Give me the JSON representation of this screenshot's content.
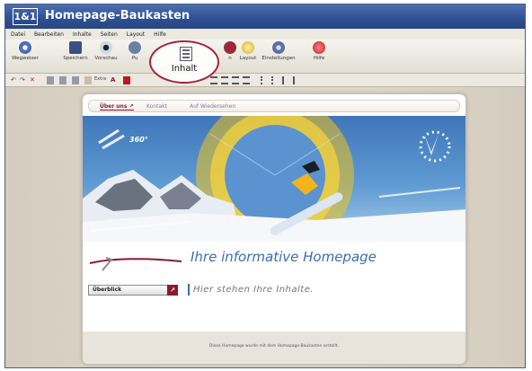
{
  "app": {
    "logo": "1&1",
    "title": "Homepage-Baukasten"
  },
  "menu": [
    "Datei",
    "Bearbeiten",
    "Inhalte",
    "Seiten",
    "Layout",
    "Hilfe"
  ],
  "toolbar": {
    "buttons": [
      {
        "label": "Wegweiser",
        "icon": "compass-icon"
      },
      {
        "label": "Speichern",
        "icon": "save-icon"
      },
      {
        "label": "Vorschau",
        "icon": "preview-icon"
      },
      {
        "label": "Pu",
        "icon": "publish-icon"
      },
      {
        "label": "Inhalt",
        "icon": "content-icon"
      },
      {
        "label": "n",
        "icon": "pages-icon"
      },
      {
        "label": "Layout",
        "icon": "layout-icon"
      },
      {
        "label": "Einstellungen",
        "icon": "settings-icon"
      },
      {
        "label": "Hilfe",
        "icon": "help-icon"
      }
    ]
  },
  "highlight": {
    "label": "Inhalt"
  },
  "toolbar2": {
    "extra": "Extra"
  },
  "page": {
    "nav": [
      {
        "label": "Über uns"
      },
      {
        "label": "Kontakt"
      },
      {
        "label": "Auf Wiedersehen"
      }
    ],
    "banner": {
      "badge": "360°"
    },
    "headline": "Ihre informative Homepage",
    "sidebar_item": "Überblick",
    "content": "Hier stehen Ihre Inhalte.",
    "footer": "Diese Homepage wurde mit dem Homepage-Baukasten erstellt."
  },
  "colors": {
    "brand": "#2e4f92",
    "accent": "#8b1a2c",
    "headline": "#3e6bb4"
  }
}
